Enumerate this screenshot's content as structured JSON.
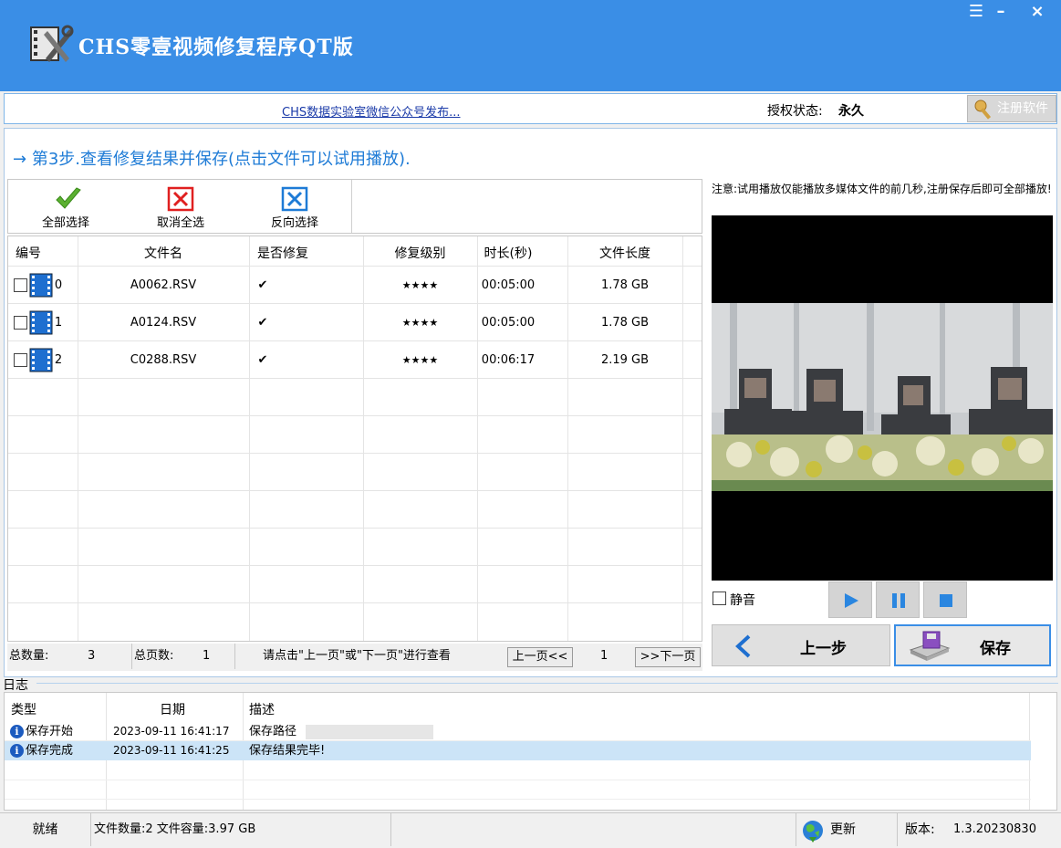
{
  "window": {
    "title": "CHS零壹视频修复程序QT版",
    "controls": {
      "menu": "☰",
      "minimize": "–",
      "close": "×"
    }
  },
  "infobar": {
    "wechat_link": "CHS数据实验室微信公众号发布...",
    "auth_label": "授权状态:",
    "auth_value": "永久",
    "register_label": "注册软件"
  },
  "step": {
    "arrow": "→",
    "title": "第3步.查看修复结果并保存(点击文件可以试用播放)."
  },
  "toolbar": {
    "select_all": "全部选择",
    "deselect_all": "取消全选",
    "invert": "反向选择"
  },
  "table": {
    "columns": [
      "编号",
      "文件名",
      "是否修复",
      "修复级别",
      "时长(秒)",
      "文件长度"
    ],
    "rows": [
      {
        "index": "0",
        "name": "A0062.RSV",
        "repaired": "✔",
        "level": "★★★★",
        "duration": "00:05:00",
        "size": "1.78 GB"
      },
      {
        "index": "1",
        "name": "A0124.RSV",
        "repaired": "✔",
        "level": "★★★★",
        "duration": "00:05:00",
        "size": "1.78 GB"
      },
      {
        "index": "2",
        "name": "C0288.RSV",
        "repaired": "✔",
        "level": "★★★★",
        "duration": "00:06:17",
        "size": "2.19 GB"
      }
    ]
  },
  "pager": {
    "total_count_label": "总数量:",
    "total_count": "3",
    "total_pages_label": "总页数:",
    "total_pages": "1",
    "hint": "请点击\"上一页\"或\"下一页\"进行查看",
    "prev": "上一页<<",
    "page": "1",
    "next": ">>下一页"
  },
  "preview": {
    "notice": "注意:试用播放仅能播放多媒体文件的前几秒,注册保存后即可全部播放!",
    "mute": "静音"
  },
  "nav": {
    "prev_step": "上一步",
    "save": "保存"
  },
  "log": {
    "title": "日志",
    "columns": [
      "类型",
      "日期",
      "描述"
    ],
    "rows": [
      {
        "type": "保存开始",
        "date": "2023-09-11 16:41:17",
        "desc": "保存路径"
      },
      {
        "type": "保存完成",
        "date": "2023-09-11 16:41:25",
        "desc": "保存结果完毕!"
      }
    ]
  },
  "status": {
    "ready": "就绪",
    "files": "文件数量:2 文件容量:3.97 GB",
    "update": "更新",
    "version_label": "版本:",
    "version": "1.3.20230830"
  },
  "colors": {
    "accent": "#3a8ee6",
    "step_text": "#1e7bd6",
    "link": "#1a3aa8",
    "selected_row": "#cce4f7"
  }
}
